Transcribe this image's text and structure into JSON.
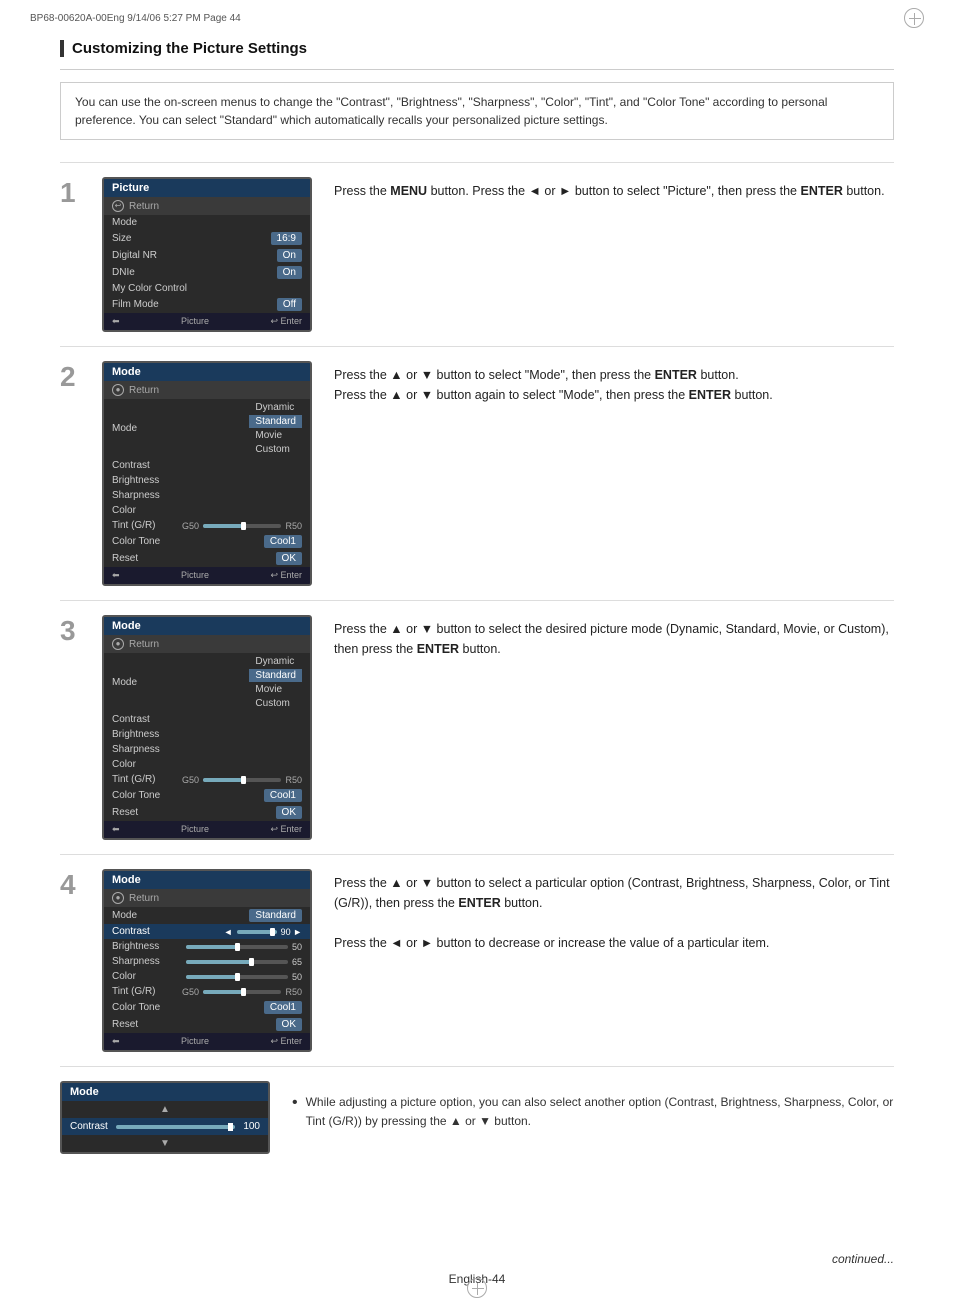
{
  "header": {
    "text": "BP68-00620A-00Eng   9/14/06   5:27 PM   Page 44"
  },
  "section": {
    "title": "Customizing the Picture Settings"
  },
  "intro": {
    "text": "You can use the on-screen menus to change the \"Contrast\", \"Brightness\", \"Sharpness\", \"Color\",  \"Tint\", and \"Color Tone\" according to personal preference. You can select \"Standard\" which automatically recalls your personalized picture settings."
  },
  "steps": [
    {
      "number": "1",
      "instruction": "Press the MENU button. Press the ◄ or ► button to select \"Picture\", then press the ENTER button.",
      "screen": {
        "title": "Picture",
        "rows": [
          {
            "label": "↩ Return",
            "type": "return"
          },
          {
            "label": "Mode",
            "type": "plain"
          },
          {
            "label": "Size",
            "value": "16:9"
          },
          {
            "label": "Digital NR",
            "value": "On"
          },
          {
            "label": "DNIe",
            "value": "On"
          },
          {
            "label": "My Color Control",
            "type": "plain"
          },
          {
            "label": "Film Mode",
            "value": "Off"
          }
        ],
        "bottom": [
          "◄",
          "Picture",
          "↩ Enter"
        ]
      }
    },
    {
      "number": "2",
      "instruction": "Press the ▲ or ▼ button to select \"Mode\", then press the ENTER button. Press the ▲ or ▼ button again to select \"Mode\", then press the ENTER button.",
      "screen": {
        "title": "Mode",
        "modeList": [
          "Dynamic",
          "Standard",
          "Movie",
          "Custom"
        ],
        "selectedMode": "Standard",
        "rows": [
          {
            "label": "↩ Return",
            "type": "return"
          },
          {
            "label": "Mode",
            "type": "plain"
          },
          {
            "label": "Contrast",
            "type": "plain"
          },
          {
            "label": "Brightness",
            "type": "plain"
          },
          {
            "label": "Sharpness",
            "type": "plain"
          },
          {
            "label": "Color",
            "type": "plain"
          },
          {
            "label": "Tint (G/R)",
            "type": "slider",
            "left": "G50",
            "right": "R50"
          },
          {
            "label": "Color Tone",
            "value": "Cool1"
          },
          {
            "label": "Reset",
            "value": "OK"
          }
        ],
        "bottom": [
          "◄",
          "Picture",
          "↩ Enter"
        ]
      }
    },
    {
      "number": "3",
      "instruction": "Press the ▲ or ▼ button to select the desired picture mode (Dynamic, Standard, Movie, or Custom), then press the ENTER button.",
      "screen": {
        "title": "Mode",
        "modeList": [
          "Dynamic",
          "Standard",
          "Movie",
          "Custom"
        ],
        "selectedMode": "Standard",
        "rows": [
          {
            "label": "↩ Return",
            "type": "return"
          },
          {
            "label": "Mode",
            "type": "plain"
          },
          {
            "label": "Contrast",
            "type": "plain"
          },
          {
            "label": "Brightness",
            "type": "plain"
          },
          {
            "label": "Sharpness",
            "type": "plain"
          },
          {
            "label": "Color",
            "type": "plain"
          },
          {
            "label": "Tint (G/R)",
            "type": "slider",
            "left": "G50",
            "right": "R50"
          },
          {
            "label": "Color Tone",
            "value": "Cool1"
          },
          {
            "label": "Reset",
            "value": "OK"
          }
        ],
        "bottom": [
          "◄",
          "Picture",
          "↩ Enter"
        ]
      }
    },
    {
      "number": "4",
      "instruction": "Press the ▲ or ▼ button to select a particular option (Contrast, Brightness, Sharpness, Color, or Tint (G/R)), then press the ENTER button.",
      "instruction2": "Press the ◄ or ► button to decrease or increase the value of a particular item.",
      "screen": {
        "title": "Mode",
        "selectedMode2": "Standard",
        "contrastVal": "90",
        "brightnessVal": "50",
        "sharpnessVal": "65",
        "colorVal": "50",
        "bottom": [
          "◄",
          "Picture",
          "↩ Enter"
        ]
      }
    }
  ],
  "note": {
    "text": "While adjusting a picture option, you can also select another option (Contrast, Brightness, Sharpness, Color, or Tint (G/R)) by pressing the ▲ or ▼ button."
  },
  "footer": {
    "continued": "continued...",
    "page": "English-44"
  },
  "smallScreen": {
    "title": "Mode",
    "label": "Contrast",
    "value": "100"
  }
}
